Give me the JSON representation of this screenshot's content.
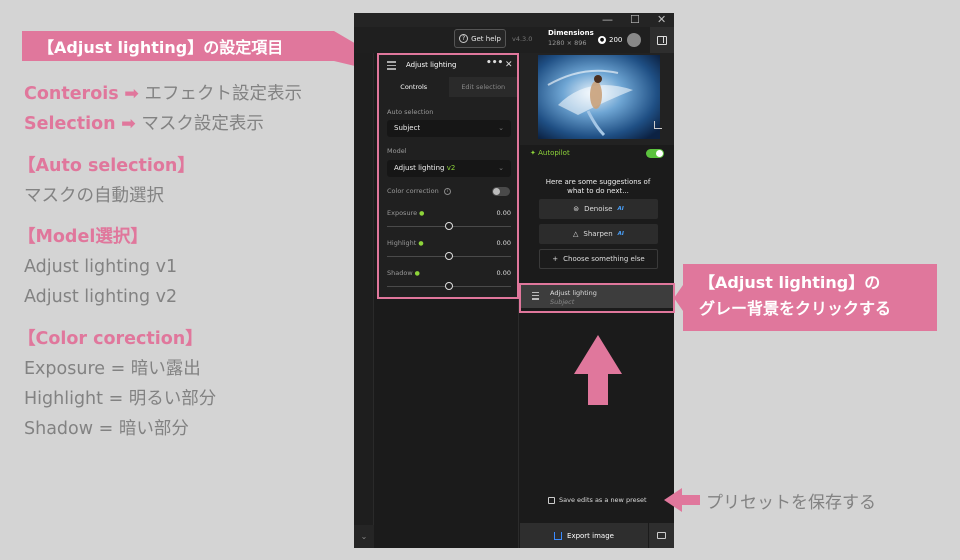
{
  "annotation": {
    "title": "【Adjust lighting】の設定項目",
    "line1_term": "Conterois",
    "line1_desc": "エフェクト設定表示",
    "line2_term": "Selection",
    "line2_desc": "マスク設定表示",
    "auto_heading": "【Auto selection】",
    "auto_desc": "マスクの自動選択",
    "model_heading": "【Model選択】",
    "model_v1": "Adjust lighting v1",
    "model_v2": "Adjust lighting v2",
    "color_heading": "【Color corection】",
    "exposure_desc": "Exposure = 暗い露出",
    "highlight_desc": "Highlight = 明るい部分",
    "shadow_desc": "Shadow = 暗い部分",
    "callout_line1": "【Adjust lighting】の",
    "callout_line2": "グレー背景をクリックする",
    "preset_note": "プリセットを保存する",
    "arrow_glyph": "➡",
    "colors": {
      "accent_pink": "#e0779c",
      "note_gray": "#828282",
      "app_green": "#8ed43a"
    }
  },
  "app": {
    "window_controls": {
      "minimize": "—",
      "maximize": "☐",
      "close": "✕"
    },
    "toolbar": {
      "get_help": "Get help",
      "version": "v4.3.0",
      "dimensions_label": "Dimensions",
      "dimensions_value": "1280 × 896",
      "credits": "200"
    },
    "adjust_panel": {
      "title": "Adjust lighting",
      "menu_glyph": "•••",
      "close_glyph": "✕",
      "tabs": [
        "Controls",
        "Edit selection"
      ],
      "auto_selection_label": "Auto selection",
      "auto_selection_value": "Subject",
      "model_label": "Model",
      "model_value": "Adjust lighting",
      "model_version": "v2",
      "color_correction_label": "Color correction",
      "color_correction_on": false,
      "sliders": [
        {
          "label": "Exposure",
          "value": "0.00",
          "position": 0.5
        },
        {
          "label": "Highlight",
          "value": "0.00",
          "position": 0.5
        },
        {
          "label": "Shadow",
          "value": "0.00",
          "position": 0.5
        }
      ]
    },
    "right_panel": {
      "autopilot_label": "Autopilot",
      "autopilot_on": true,
      "suggestions_text": "Here are some suggestions of what to do next...",
      "buttons": [
        "Denoise",
        "Sharpen",
        "Choose something else"
      ],
      "ai_badge": "AI",
      "layer_name": "Adjust lighting",
      "layer_sub": "Subject",
      "save_preset": "Save edits as a new preset",
      "export": "Export image"
    }
  }
}
